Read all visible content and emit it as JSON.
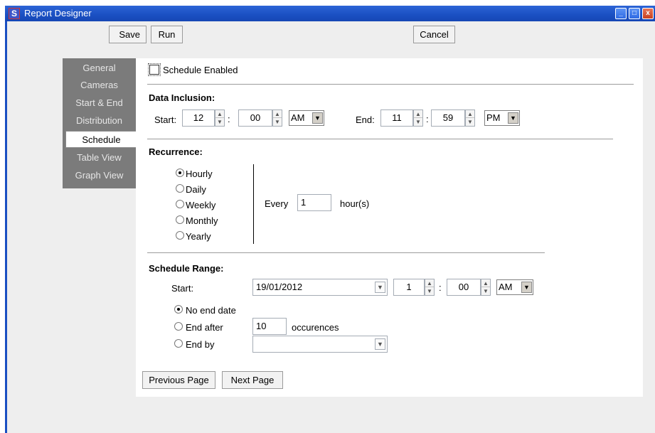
{
  "window": {
    "title": "Report Designer",
    "app_icon_letter": "S",
    "minimize_glyph": "_",
    "maximize_glyph": "□",
    "close_glyph": "x"
  },
  "toolbar": {
    "save": "Save",
    "run": "Run",
    "cancel": "Cancel"
  },
  "nav": {
    "items": [
      "General",
      "Cameras",
      "Start & End",
      "Distribution",
      "Schedule",
      "Table View",
      "Graph View"
    ],
    "selected": "Schedule"
  },
  "schedule_enabled": {
    "label": "Schedule Enabled",
    "checked": false
  },
  "data_inclusion": {
    "title": "Data Inclusion:",
    "start_label": "Start:",
    "start_hour": "12",
    "start_minute": "00",
    "start_ampm": "AM",
    "end_label": "End:",
    "end_hour": "11",
    "end_minute": "59",
    "end_ampm": "PM",
    "colon": ":"
  },
  "recurrence": {
    "title": "Recurrence:",
    "options": [
      "Hourly",
      "Daily",
      "Weekly",
      "Monthly",
      "Yearly"
    ],
    "selected": "Hourly",
    "every_label": "Every",
    "every_value": "1",
    "unit_label": "hour(s)"
  },
  "schedule_range": {
    "title": "Schedule Range:",
    "start_label": "Start:",
    "start_date": "19/01/2012",
    "start_hour": "1",
    "start_minute": "00",
    "start_ampm": "AM",
    "colon": ":",
    "no_end_label": "No end date",
    "end_after_label": "End after",
    "end_after_value": "10",
    "occurrences_label": "occurences",
    "end_by_label": "End by",
    "end_by_value": "",
    "selected": "No end date"
  },
  "footer": {
    "previous": "Previous Page",
    "next": "Next Page"
  },
  "icons": {
    "spin_up": "▲",
    "spin_down": "▼",
    "dropdown": "▼"
  }
}
